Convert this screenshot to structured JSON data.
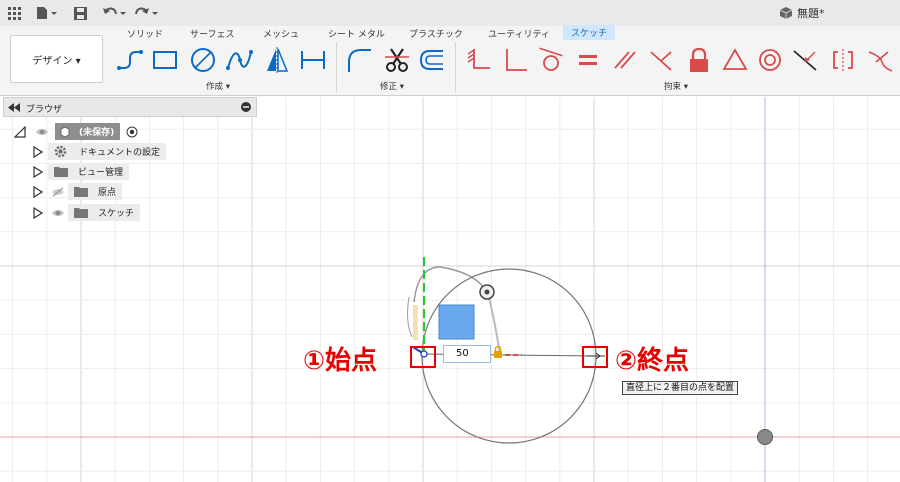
{
  "document": {
    "title": "無題*"
  },
  "ribbon": {
    "tabs": [
      {
        "label": "ソリッド"
      },
      {
        "label": "サーフェス"
      },
      {
        "label": "メッシュ"
      },
      {
        "label": "シート メタル"
      },
      {
        "label": "プラスチック"
      },
      {
        "label": "ユーティリティ"
      },
      {
        "label": "スケッチ"
      }
    ],
    "active_tab": "スケッチ",
    "workspace": "デザイン ▾",
    "groups": {
      "create": "作成 ▾",
      "modify": "修正 ▾",
      "constraints": "拘束 ▾"
    }
  },
  "browser": {
    "title": "ブラウザ",
    "root": "(未保存)",
    "items": [
      {
        "label": "ドキュメントの設定",
        "icon": "gear-icon"
      },
      {
        "label": "ビュー管理",
        "icon": "folder-icon"
      },
      {
        "label": "原点",
        "icon": "folder-icon"
      },
      {
        "label": "スケッチ",
        "icon": "folder-icon"
      }
    ]
  },
  "sketch": {
    "dimension_value": "50",
    "hint": "直径上に２番目の点を配置",
    "annotation_start": "①始点",
    "annotation_end": "②終点"
  },
  "colors": {
    "accent": "#0a6bc6",
    "annotation_red": "#e60000",
    "x_axis": "#e8a0a0",
    "y_axis": "#b0b0e8",
    "constraint_red": "#d94b4b"
  }
}
